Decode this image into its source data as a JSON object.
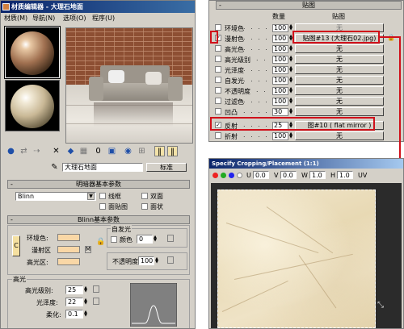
{
  "material_editor": {
    "title": "材质编辑器 - 大理石地面",
    "menu": [
      "材质(M)",
      "导航(N)",
      "选项(O)",
      "程序(U)"
    ],
    "material_name": "大理石地面",
    "type_button": "标准",
    "shader_rollout": {
      "title": "明暗器基本参数",
      "shader": "Blinn",
      "options": [
        "线框",
        "双面",
        "面贴图",
        "面状"
      ]
    },
    "blinn_rollout": {
      "title": "Blinn基本参数",
      "self_illum_title": "自发光",
      "self_illum_color_label": "颜色",
      "self_illum_value": "0",
      "ambient_label": "环境色:",
      "diffuse_label": "漫射区",
      "specular_label": "高光区:",
      "lock_letter": "C",
      "map_letter": "M",
      "opacity_label": "不透明度",
      "opacity_value": "100"
    },
    "specular_section": {
      "title": "高光",
      "level_label": "高光级别:",
      "level_value": "25",
      "gloss_label": "光泽度:",
      "gloss_value": "22",
      "soften_label": "柔化:",
      "soften_value": "0.1"
    },
    "colors": {
      "swatch": "#f9d7a6",
      "title_bar": "#0a246a"
    }
  },
  "maps_panel": {
    "title": "贴图",
    "col_amount": "数量",
    "col_map": "贴图",
    "rows": [
      {
        "label": "环境色",
        "amount": "100",
        "map": "无",
        "checked": false,
        "dim": true
      },
      {
        "label": "漫射色",
        "amount": "100",
        "map": "贴图#13 (大理石02.jpg)",
        "checked": true,
        "dim": false
      },
      {
        "label": "高光色",
        "amount": "100",
        "map": "无",
        "checked": false,
        "dim": false
      },
      {
        "label": "高光级别",
        "amount": "100",
        "map": "无",
        "checked": false,
        "dim": false
      },
      {
        "label": "光泽度",
        "amount": "100",
        "map": "无",
        "checked": false,
        "dim": false
      },
      {
        "label": "自发光",
        "amount": "100",
        "map": "无",
        "checked": false,
        "dim": false
      },
      {
        "label": "不透明度",
        "amount": "100",
        "map": "无",
        "checked": false,
        "dim": false
      },
      {
        "label": "过滤色",
        "amount": "100",
        "map": "无",
        "checked": false,
        "dim": false
      },
      {
        "label": "凹凸",
        "amount": "30",
        "map": "无",
        "checked": false,
        "dim": false
      },
      {
        "label": "反射",
        "amount": "25",
        "map": "图#10  ( flat mirror )",
        "checked": true,
        "dim": false
      },
      {
        "label": "折射",
        "amount": "100",
        "map": "无",
        "checked": false,
        "dim": false
      }
    ],
    "highlight_color": "#d0101a"
  },
  "crop_window": {
    "title": "Specify Cropping/Placement (1:1)",
    "u_label": "U",
    "u_value": "0.0",
    "v_label": "V",
    "v_value": "0.0",
    "w_label": "W",
    "w_value": "1.0",
    "h_label": "H",
    "h_value": "1.0",
    "uv_label": "UV"
  }
}
